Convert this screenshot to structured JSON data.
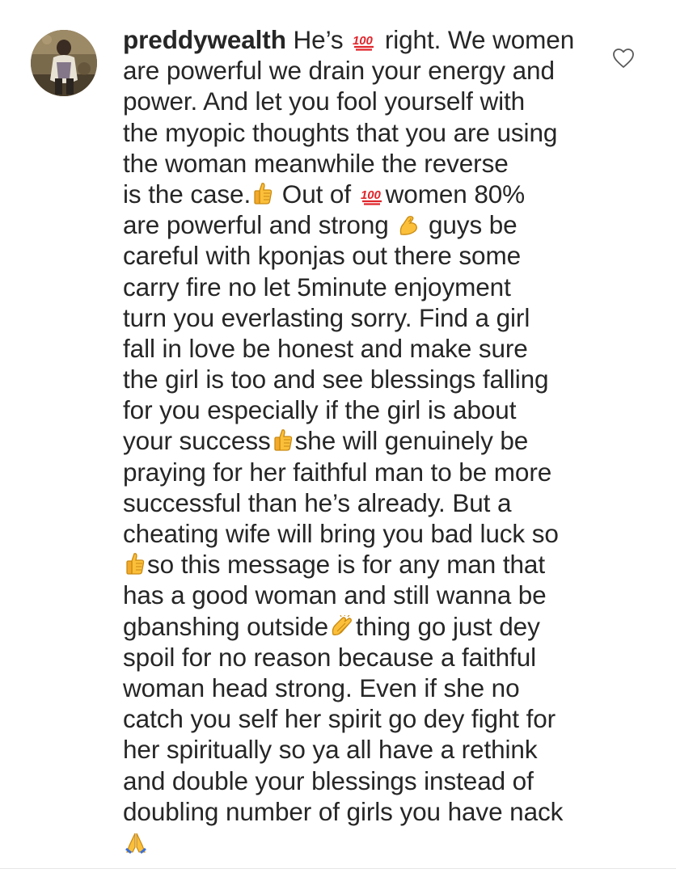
{
  "comment": {
    "username": "preddywealth",
    "avatar_icon": "profile-photo",
    "like_icon": "heart-outline-icon",
    "lines": [
      [
        {
          "t": "text",
          "v": " He’s "
        },
        {
          "t": "emoji",
          "v": "hundred-points-icon"
        },
        {
          "t": "text",
          "v": " right. We women"
        }
      ],
      [
        {
          "t": "text",
          "v": "are powerful we drain your energy and"
        }
      ],
      [
        {
          "t": "text",
          "v": "power. And let you fool yourself with"
        }
      ],
      [
        {
          "t": "text",
          "v": "the myopic thoughts that you are using"
        }
      ],
      [
        {
          "t": "text",
          "v": "the woman meanwhile the reverse"
        }
      ],
      [
        {
          "t": "text",
          "v": "is the case."
        },
        {
          "t": "emoji",
          "v": "thumbs-up-icon"
        },
        {
          "t": "text",
          "v": " Out of "
        },
        {
          "t": "emoji",
          "v": "hundred-points-icon"
        },
        {
          "t": "text",
          "v": "women 80%"
        }
      ],
      [
        {
          "t": "text",
          "v": "are powerful and strong "
        },
        {
          "t": "emoji",
          "v": "flexed-biceps-icon"
        },
        {
          "t": "text",
          "v": " guys be"
        }
      ],
      [
        {
          "t": "text",
          "v": "careful with kponjas out there some"
        }
      ],
      [
        {
          "t": "text",
          "v": "carry fire no let 5minute enjoyment"
        }
      ],
      [
        {
          "t": "text",
          "v": "turn you everlasting sorry. Find a girl"
        }
      ],
      [
        {
          "t": "text",
          "v": "fall in love be honest and make sure"
        }
      ],
      [
        {
          "t": "text",
          "v": "the girl is too and see blessings falling"
        }
      ],
      [
        {
          "t": "text",
          "v": "for you especially if the girl is about"
        }
      ],
      [
        {
          "t": "text",
          "v": "your success"
        },
        {
          "t": "emoji",
          "v": "thumbs-up-icon"
        },
        {
          "t": "text",
          "v": "she will genuinely be"
        }
      ],
      [
        {
          "t": "text",
          "v": "praying for her faithful man to be more"
        }
      ],
      [
        {
          "t": "text",
          "v": "successful than he’s  already. But a"
        }
      ],
      [
        {
          "t": "text",
          "v": "cheating wife will bring you bad luck so"
        }
      ],
      [
        {
          "t": "emoji",
          "v": "thumbs-up-icon"
        },
        {
          "t": "text",
          "v": "so this message is for any man that"
        }
      ],
      [
        {
          "t": "text",
          "v": "has a good woman and still wanna be"
        }
      ],
      [
        {
          "t": "text",
          "v": "gbanshing outside"
        },
        {
          "t": "emoji",
          "v": "clapping-hands-icon"
        },
        {
          "t": "text",
          "v": "thing go just dey"
        }
      ],
      [
        {
          "t": "text",
          "v": "spoil for no reason because a faithful"
        }
      ],
      [
        {
          "t": "text",
          "v": "woman head strong. Even if she no"
        }
      ],
      [
        {
          "t": "text",
          "v": "catch you self her spirit go dey fight for"
        }
      ],
      [
        {
          "t": "text",
          "v": "her spiritually so ya all have a rethink"
        }
      ],
      [
        {
          "t": "text",
          "v": "and double your blessings instead of"
        }
      ],
      [
        {
          "t": "text",
          "v": "doubling number of girls you have nack"
        }
      ],
      [
        {
          "t": "emoji",
          "v": "folded-hands-icon"
        }
      ]
    ]
  }
}
